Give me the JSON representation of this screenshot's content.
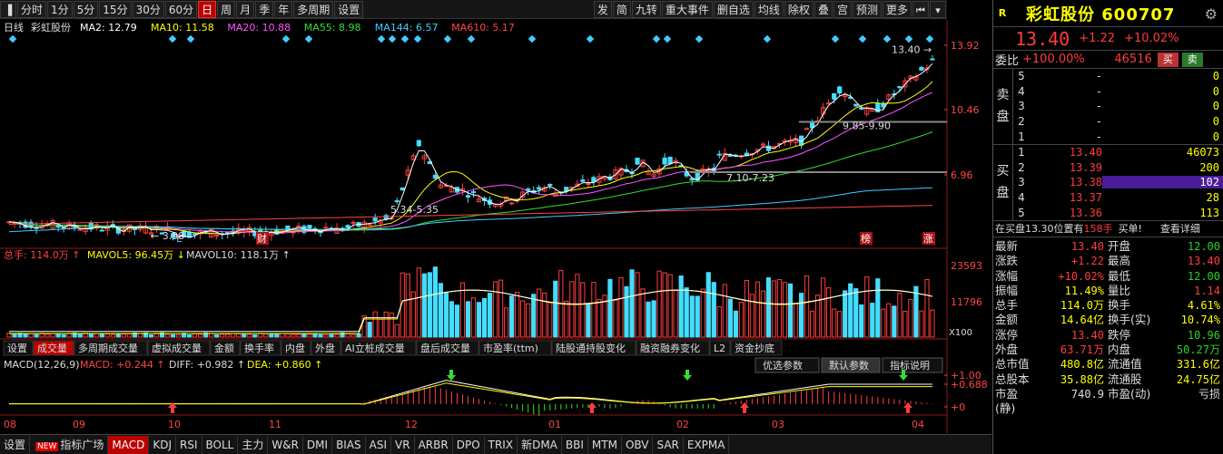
{
  "toolbar": {
    "left": [
      "分时",
      "1分",
      "5分",
      "15分",
      "30分",
      "60分",
      "日",
      "周",
      "月",
      "季",
      "年",
      "多周期",
      "设置"
    ],
    "active": "日",
    "right": [
      "发",
      "简",
      "九转",
      "重大事件",
      "删自选",
      "均线",
      "除权",
      "叠",
      "宫",
      "预测",
      "更多"
    ]
  },
  "chart_header": {
    "period": "日线",
    "name": "彩虹股份",
    "ma": [
      {
        "label": "MA2: 12.79",
        "color": "#ffffff"
      },
      {
        "label": "MA10: 11.58",
        "color": "#ffff00"
      },
      {
        "label": "MA20: 10.88",
        "color": "#ff55ff"
      },
      {
        "label": "MA55: 8.98",
        "color": "#33dd33"
      },
      {
        "label": "MA144: 6.57",
        "color": "#44ccff"
      },
      {
        "label": "MA610: 5.17",
        "color": "#ff4444"
      }
    ]
  },
  "price_axis": [
    "13.92",
    "10.46",
    "6.96"
  ],
  "price_annotations": {
    "high": "13.40",
    "range1": "9.85-9.90",
    "range2": "7.10-7.23",
    "range3": "5.34-5.35",
    "low": "3.98"
  },
  "event_marks": {
    "l": "L",
    "cai": "财",
    "bang": "榜",
    "zhang": "涨"
  },
  "volume_header": {
    "total": "总手: 114.0万",
    "mavol5": "MAVOL5: 96.45万",
    "mavol10": "MAVOL10: 118.1万"
  },
  "volume_axis": [
    "23593",
    "11796",
    "X100"
  ],
  "indicator_tabs": [
    "设置",
    "成交量",
    "多周期成交量",
    "虚拟成交量",
    "金额",
    "换手率",
    "内盘",
    "外盘",
    "AI立桩成交量",
    "盘后成交量",
    "市盈率(ttm)",
    "陆股通持股变化",
    "融资融券变化",
    "L2",
    "资金抄底"
  ],
  "indicator_active": "成交量",
  "macd_header": {
    "name": "MACD(12,26,9)",
    "macd": "MACD: +0.244",
    "diff": "DIFF: +0.982",
    "dea": "DEA: +0.860"
  },
  "macd_buttons": [
    "优选参数",
    "默认参数",
    "指标说明"
  ],
  "macd_axis": [
    "+1.00",
    "+0.688",
    "+0"
  ],
  "months": [
    "08",
    "09",
    "10",
    "11",
    "12",
    "01",
    "02",
    "03",
    "04"
  ],
  "bottom_tabs": [
    "设置",
    "指标广场",
    "MACD",
    "KDJ",
    "RSI",
    "BOLL",
    "主力",
    "W&R",
    "DMI",
    "BIAS",
    "ASI",
    "VR",
    "ARBR",
    "DPO",
    "TRIX",
    "新DMA",
    "BBI",
    "MTM",
    "OBV",
    "SAR",
    "EXPMA"
  ],
  "bottom_new": "NEW",
  "bottom_active": "MACD",
  "quote": {
    "r": "R",
    "title": "彩虹股份 600707",
    "price": "13.40",
    "change": "+1.22",
    "pct": "+10.02%",
    "weibi_label": "委比",
    "weibi": "+100.00%",
    "weicha": "46516",
    "buy_btn": "买",
    "sell_btn": "卖",
    "sell_side_label": [
      "卖",
      "盘"
    ],
    "buy_side_label": [
      "买",
      "盘"
    ],
    "asks": [
      {
        "lv": "5",
        "price": "-",
        "qty": "0"
      },
      {
        "lv": "4",
        "price": "-",
        "qty": "0"
      },
      {
        "lv": "3",
        "price": "-",
        "qty": "0"
      },
      {
        "lv": "2",
        "price": "-",
        "qty": "0"
      },
      {
        "lv": "1",
        "price": "-",
        "qty": "0"
      }
    ],
    "bids": [
      {
        "lv": "1",
        "price": "13.40",
        "qty": "46073"
      },
      {
        "lv": "2",
        "price": "13.39",
        "qty": "200"
      },
      {
        "lv": "3",
        "price": "13.38",
        "qty": "102"
      },
      {
        "lv": "4",
        "price": "13.37",
        "qty": "28"
      },
      {
        "lv": "5",
        "price": "13.36",
        "qty": "113"
      }
    ],
    "notice": {
      "a": "在买盘13.30位置有",
      "b": "158手",
      "c": "买单!",
      "d": "查看详细"
    },
    "stats": [
      [
        "最新",
        "13.40",
        "开盘",
        "12.00"
      ],
      [
        "涨跌",
        "+1.22",
        "最高",
        "13.40"
      ],
      [
        "涨幅",
        "+10.02%",
        "最低",
        "12.00"
      ],
      [
        "振幅",
        "11.49%",
        "量比",
        "1.14"
      ],
      [
        "总手",
        "114.0万",
        "换手",
        "4.61%"
      ],
      [
        "金额",
        "14.64亿",
        "换手(实)",
        "10.74%"
      ],
      [
        "涨停",
        "13.40",
        "跌停",
        "10.96"
      ],
      [
        "外盘",
        "63.71万",
        "内盘",
        "50.27万"
      ],
      [
        "总市值",
        "480.8亿",
        "流通值",
        "331.6亿"
      ],
      [
        "总股本",
        "35.88亿",
        "流通股",
        "24.75亿"
      ],
      [
        "市盈(静)",
        "740.9",
        "市盈(动)",
        "亏损"
      ]
    ]
  }
}
